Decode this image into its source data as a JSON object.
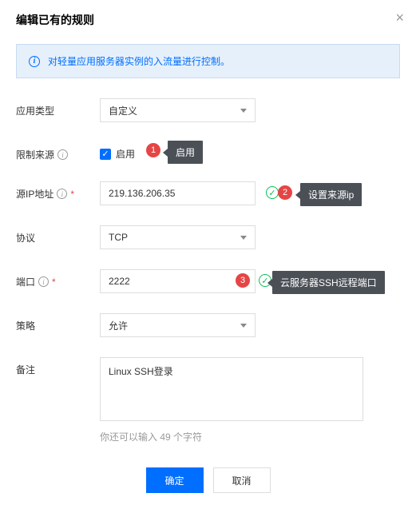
{
  "title": "编辑已有的规则",
  "banner": "对轻量应用服务器实例的入流量进行控制。",
  "labels": {
    "app_type": "应用类型",
    "restrict_source": "限制来源",
    "source_ip": "源IP地址",
    "protocol": "协议",
    "port": "端口",
    "policy": "策略",
    "remark": "备注"
  },
  "values": {
    "app_type": "自定义",
    "enable": "启用",
    "source_ip": "219.136.206.35",
    "protocol": "TCP",
    "port": "2222",
    "policy": "允许",
    "remark": "Linux SSH登录"
  },
  "annotations": {
    "n1": "1",
    "n2": "2",
    "n3": "3",
    "t1": "启用",
    "t2": "设置来源ip",
    "t3": "云服务器SSH远程端口"
  },
  "char_hint": "你还可以输入 49 个字符",
  "buttons": {
    "ok": "确定",
    "cancel": "取消"
  }
}
